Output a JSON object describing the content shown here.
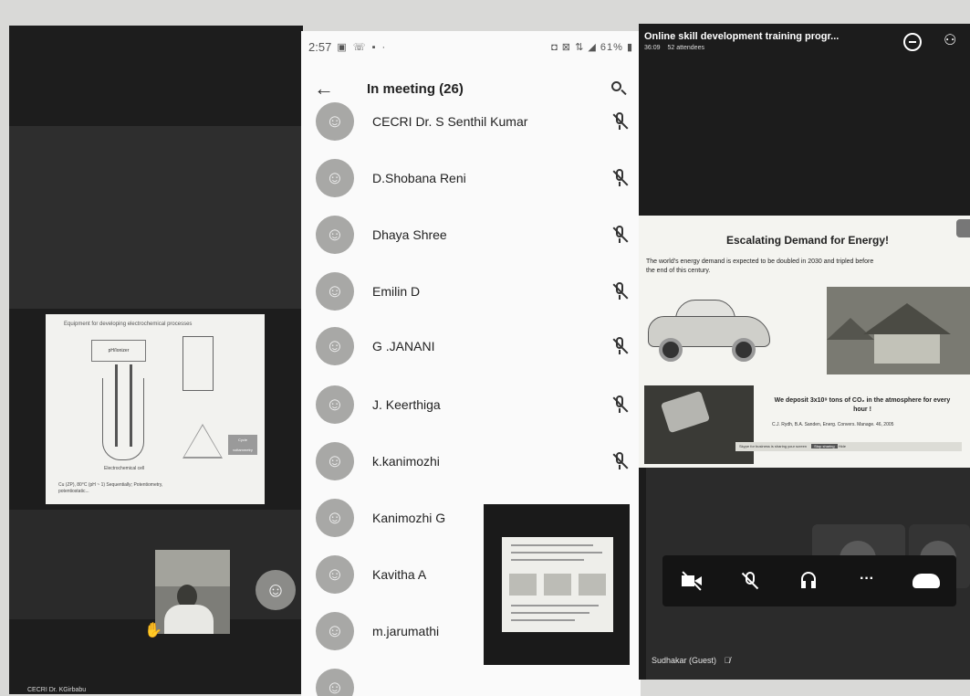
{
  "phone": {
    "status_bar": {
      "time": "2:57",
      "left_icons": "▣ ☏ ▪ ·",
      "right_status": "◘ ⊠ ⇅ ◢ 61% ▮"
    },
    "header": {
      "title": "In meeting (26)"
    },
    "participants": [
      {
        "name": "CECRI Dr. S Senthil Kumar",
        "muted": true
      },
      {
        "name": "D.Shobana Reni",
        "muted": true
      },
      {
        "name": "Dhaya Shree",
        "muted": true
      },
      {
        "name": "Emilin D",
        "muted": true
      },
      {
        "name": "G .JANANI",
        "muted": true
      },
      {
        "name": "J. Keerthiga",
        "muted": true
      },
      {
        "name": "k.kanimozhi",
        "muted": true
      },
      {
        "name": "Kanimozhi G",
        "muted": false
      },
      {
        "name": "Kavitha A",
        "muted": false
      },
      {
        "name": "m.jarumathi",
        "muted": false
      }
    ]
  },
  "left_meeting": {
    "slide_title": "Equipment for developing electrochemical processes",
    "slide_box_label": "pH/Ionizer",
    "slide_caption_cell": "Electrochemical cell",
    "slide_caption_small": "Cu (ZP), 80°C (pH ~ 1) Sequentially; Potentiometry, potentiostatic...",
    "slide_grey_label": "Cycle voltammetry",
    "bottom_label": "CECRI Dr. KGirbabu"
  },
  "right_meeting": {
    "title": "Online skill development training progr...",
    "duration": "36:09",
    "attendees": "52 attendees",
    "slide": {
      "title": "Escalating Demand for Energy!",
      "line": "The world's energy demand is expected to be doubled in 2030 and tripled before the end of this century.",
      "co2_text": "We deposit 3x10⁹ tons of CO₂ in the atmosphere for every hour !",
      "reference": "C.J. Rydh, B.A. Sanden, Energ. Convers. Manage. 46, 2005",
      "toast_text": "Skype for business is sharing your screen",
      "toast_button": "Stop sharing",
      "toast_hide": "Hide"
    },
    "presenter": "Sudhakar (Guest)",
    "toolbar_more": "···"
  },
  "colors": {
    "phone_bg": "#fafafa",
    "avatar_gray": "#a8a8a6",
    "dark_bg": "#1c1c1c"
  },
  "icons": [
    "back-arrow-icon",
    "search-icon",
    "mic-off-icon",
    "video-off-icon",
    "headset-icon",
    "more-icon",
    "hang-up-icon",
    "chat-icon",
    "people-icon",
    "hand-raise-icon"
  ]
}
